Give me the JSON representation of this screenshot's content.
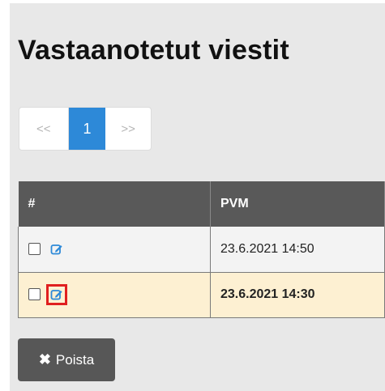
{
  "page": {
    "title": "Vastaanotetut viestit"
  },
  "pagination": {
    "prev": "<<",
    "current": "1",
    "next": ">>"
  },
  "table": {
    "headers": [
      "#",
      "PVM"
    ],
    "rows": [
      {
        "date": "23.6.2021 14:50",
        "unread": false,
        "highlighted": false
      },
      {
        "date": "23.6.2021 14:30",
        "unread": true,
        "highlighted": true
      }
    ]
  },
  "actions": {
    "delete_icon": "✖",
    "delete_label": "Poista"
  },
  "colors": {
    "accent": "#2d89d8",
    "header_bg": "#595959",
    "unread_row": "#fdf0d2",
    "highlight": "#e01f1f"
  }
}
